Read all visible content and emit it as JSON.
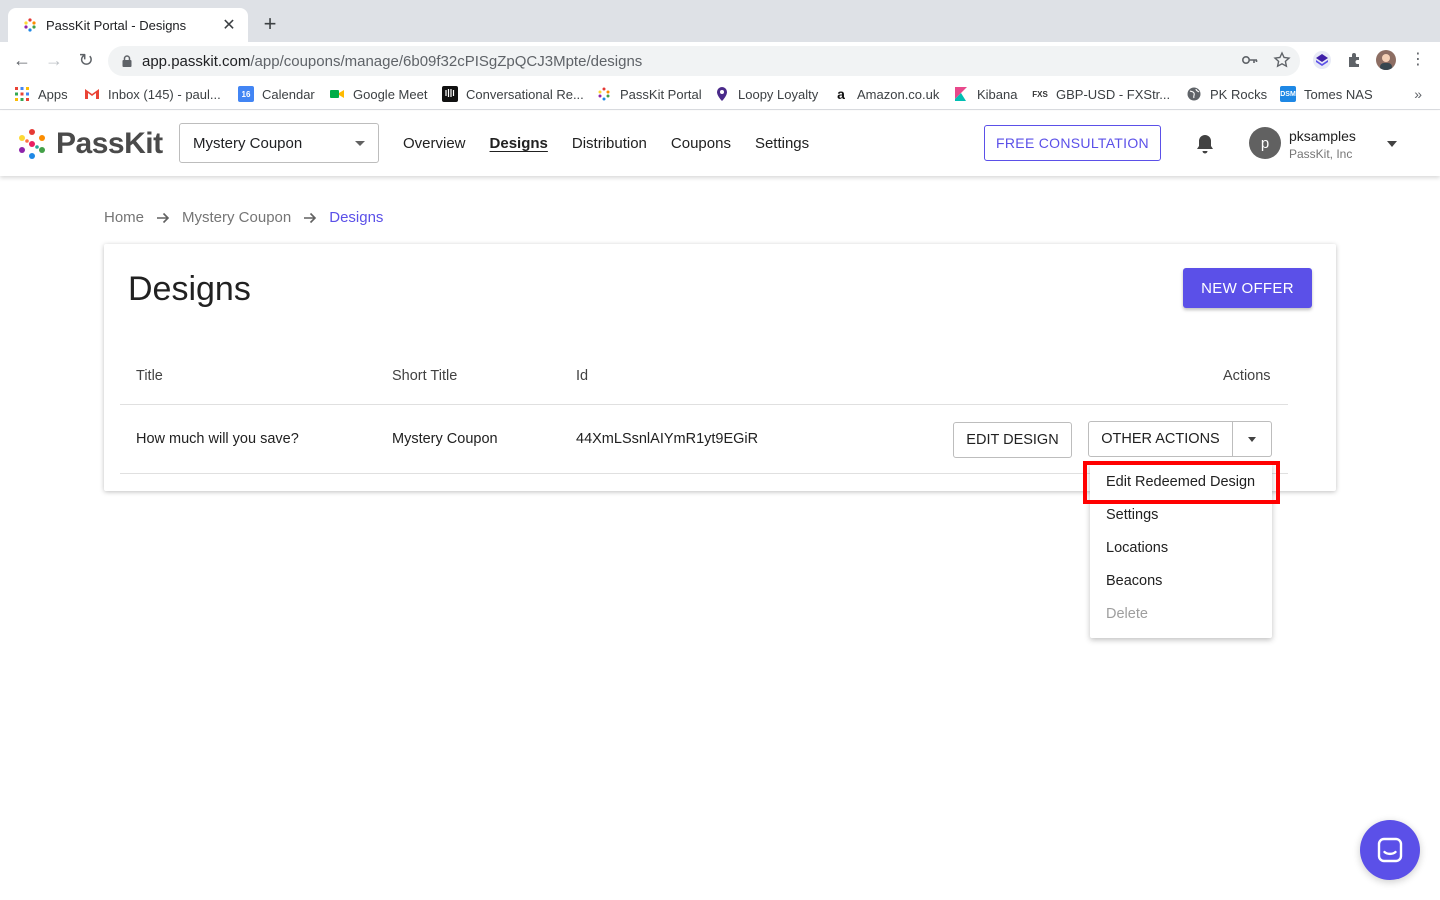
{
  "browser": {
    "tab_title": "PassKit Portal - Designs",
    "url_host": "app.passkit.com",
    "url_path": "/app/coupons/manage/6b09f32cPISgZpQCJ3Mpte/designs",
    "bookmarks": [
      {
        "label": "Apps",
        "icon": "apps-grid-icon"
      },
      {
        "label": "Inbox (145) - paul...",
        "icon": "gmail-icon"
      },
      {
        "label": "Calendar",
        "icon": "calendar-icon"
      },
      {
        "label": "Google Meet",
        "icon": "meet-icon"
      },
      {
        "label": "Conversational Re...",
        "icon": "intercom-icon"
      },
      {
        "label": "PassKit Portal",
        "icon": "passkit-icon"
      },
      {
        "label": "Loopy Loyalty",
        "icon": "location-pin-icon"
      },
      {
        "label": "Amazon.co.uk",
        "icon": "amazon-icon"
      },
      {
        "label": "Kibana",
        "icon": "kibana-icon"
      },
      {
        "label": "GBP-USD - FXStr...",
        "icon": "fxstreet-icon"
      },
      {
        "label": "PK Rocks",
        "icon": "globe-icon"
      },
      {
        "label": "Tomes NAS",
        "icon": "nas-icon"
      }
    ],
    "bookmarks_more": "»"
  },
  "app": {
    "logo_text": "PassKit",
    "project_selector": "Mystery Coupon",
    "nav": [
      "Overview",
      "Designs",
      "Distribution",
      "Coupons",
      "Settings"
    ],
    "active_nav": "Designs",
    "consultation_button": "FREE CONSULTATION",
    "user": {
      "initial": "p",
      "name": "pksamples",
      "org": "PassKit, Inc"
    }
  },
  "breadcrumb": [
    "Home",
    "Mystery Coupon",
    "Designs"
  ],
  "page": {
    "title": "Designs",
    "new_offer_button": "NEW OFFER",
    "table": {
      "headers": {
        "title": "Title",
        "short_title": "Short Title",
        "id": "Id",
        "actions": "Actions"
      },
      "rows": [
        {
          "title": "How much will you save?",
          "short_title": "Mystery Coupon",
          "id": "44XmLSsnlAIYmR1yt9EGiR"
        }
      ]
    },
    "edit_design_button": "EDIT DESIGN",
    "other_actions_button": "OTHER ACTIONS",
    "other_actions_menu": [
      {
        "label": "Edit Redeemed Design",
        "disabled": false,
        "highlighted": true
      },
      {
        "label": "Settings",
        "disabled": false
      },
      {
        "label": "Locations",
        "disabled": false
      },
      {
        "label": "Beacons",
        "disabled": false
      },
      {
        "label": "Delete",
        "disabled": true
      }
    ]
  },
  "colors": {
    "accent": "#5b50e8",
    "highlight": "#ff0000"
  }
}
